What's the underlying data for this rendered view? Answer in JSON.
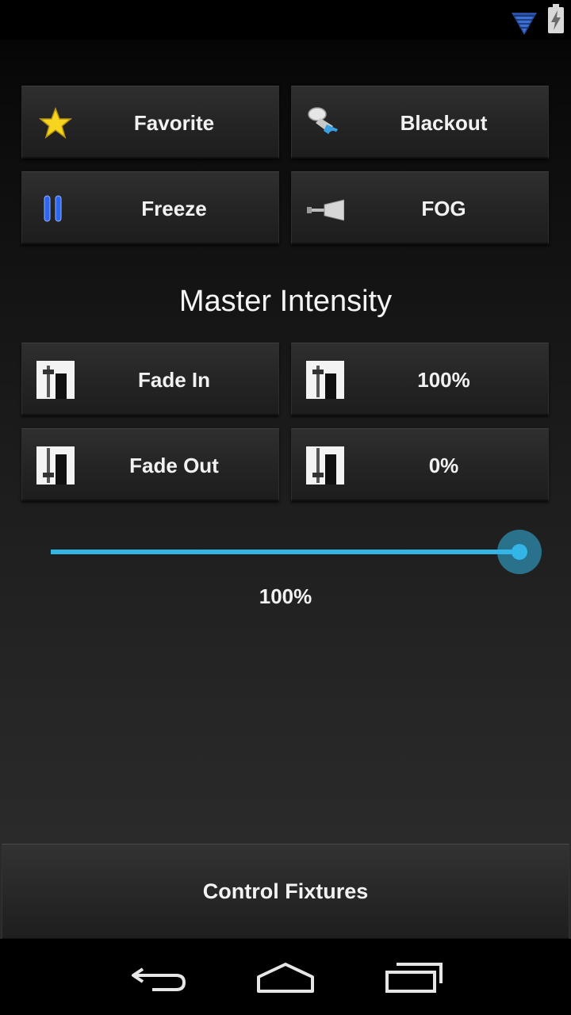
{
  "status_bar": {
    "icons": [
      "wifi-icon",
      "battery-charging-icon"
    ]
  },
  "quick_actions": {
    "favorite": {
      "label": "Favorite",
      "icon": "star-icon"
    },
    "blackout": {
      "label": "Blackout",
      "icon": "spotlight-icon"
    },
    "freeze": {
      "label": "Freeze",
      "icon": "pause-icon"
    },
    "fog": {
      "label": "FOG",
      "icon": "fog-machine-icon"
    }
  },
  "master": {
    "title": "Master Intensity",
    "fade_in": {
      "label": "Fade In",
      "icon": "fader-up-icon"
    },
    "full": {
      "label": "100%",
      "icon": "fader-up-icon"
    },
    "fade_out": {
      "label": "Fade Out",
      "icon": "fader-down-icon"
    },
    "zero": {
      "label": "0%",
      "icon": "fader-down-icon"
    },
    "slider": {
      "value": 100,
      "max": 100,
      "value_label": "100%"
    }
  },
  "footer": {
    "control_fixtures_label": "Control Fixtures"
  },
  "nav_bar": {
    "icons": [
      "back-icon",
      "home-icon",
      "recent-apps-icon"
    ]
  },
  "colors": {
    "accent": "#33b5e5",
    "text": "#f2f2f2",
    "star": "#f7d51e",
    "pause": "#2f66f0"
  }
}
